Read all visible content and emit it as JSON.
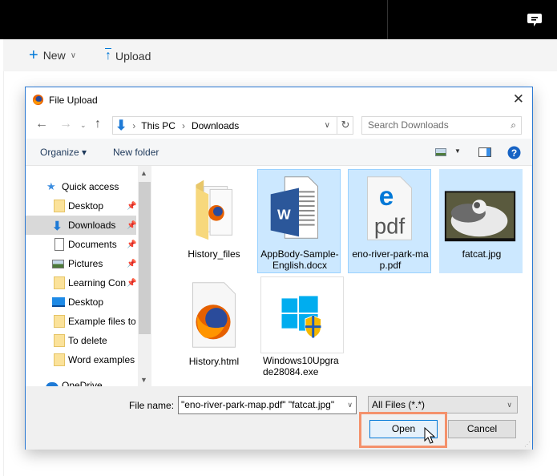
{
  "topbar": {
    "icons": [
      "chat-feedback-icon"
    ]
  },
  "commandbar": {
    "new_label": "New",
    "upload_label": "Upload"
  },
  "dialog": {
    "title": "File Upload",
    "close_glyph": "✕",
    "address": {
      "crumbs": [
        "This PC",
        "Downloads"
      ],
      "separator": "›"
    },
    "search": {
      "placeholder": "Search Downloads"
    },
    "toolbar": {
      "organize_label": "Organize ▾",
      "new_folder_label": "New folder"
    },
    "sidebar": {
      "items": [
        {
          "label": "Quick access",
          "icon": "star-icon",
          "pinned": false,
          "selected": false
        },
        {
          "label": "Desktop",
          "icon": "folder-icon",
          "pinned": true,
          "selected": false
        },
        {
          "label": "Downloads",
          "icon": "download-icon",
          "pinned": true,
          "selected": true
        },
        {
          "label": "Documents",
          "icon": "documents-icon",
          "pinned": true,
          "selected": false
        },
        {
          "label": "Pictures",
          "icon": "pictures-icon",
          "pinned": true,
          "selected": false
        },
        {
          "label": "Learning Con",
          "icon": "folder-icon",
          "pinned": true,
          "selected": false
        },
        {
          "label": "Desktop",
          "icon": "desktop-icon",
          "pinned": false,
          "selected": false
        },
        {
          "label": "Example files to",
          "icon": "folder-icon",
          "pinned": false,
          "selected": false
        },
        {
          "label": "To delete",
          "icon": "folder-icon",
          "pinned": false,
          "selected": false
        },
        {
          "label": "Word examples f",
          "icon": "folder-icon",
          "pinned": false,
          "selected": false
        },
        {
          "label": "OneDrive",
          "icon": "onedrive-icon",
          "pinned": false,
          "selected": false
        }
      ]
    },
    "files": [
      {
        "name": "History_files",
        "type": "folder",
        "selected": false
      },
      {
        "name": "AppBody-Sample-English.docx",
        "type": "docx",
        "selected": true
      },
      {
        "name": "eno-river-park-map.pdf",
        "type": "pdf",
        "selected": true
      },
      {
        "name": "fatcat.jpg",
        "type": "jpg",
        "selected": true
      },
      {
        "name": "History.html",
        "type": "html",
        "selected": false
      },
      {
        "name": "Windows10Upgrade28084.exe",
        "type": "exe",
        "selected": false
      }
    ],
    "footer": {
      "filename_label": "File name:",
      "filename_value": "\"eno-river-park-map.pdf\" \"fatcat.jpg\"",
      "filetype_value": "All Files (*.*)",
      "open_label": "Open",
      "cancel_label": "Cancel"
    }
  },
  "colors": {
    "accent": "#0078d7",
    "selection": "#cce8ff",
    "highlight_box": "#f4916b"
  }
}
